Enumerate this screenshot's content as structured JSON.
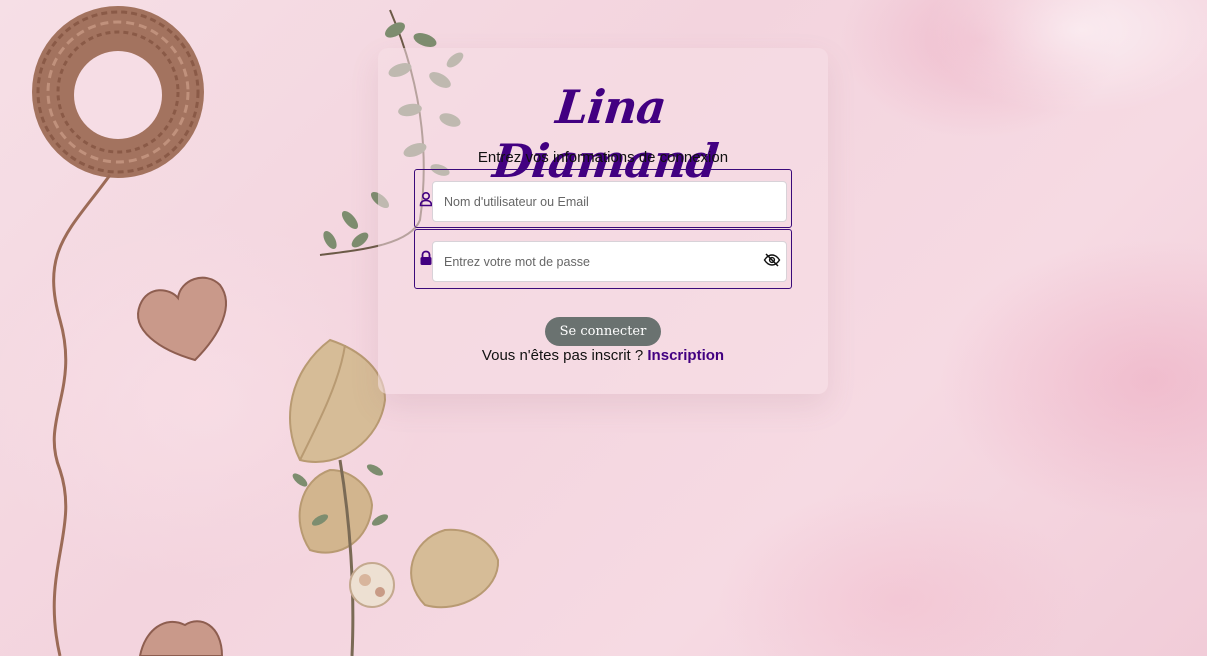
{
  "brand": {
    "title": "Lina Diamand"
  },
  "login": {
    "subtitle": "Entrez vos informations de connexion",
    "username": {
      "value": "",
      "placeholder": "Nom d'utilisateur ou Email",
      "icon": "user-icon"
    },
    "password": {
      "value": "",
      "placeholder": "Entrez votre mot de passe",
      "icon": "lock-icon",
      "toggle_icon": "eye-slash-icon"
    },
    "submit_label": "Se connecter",
    "signup_prompt": "Vous n'êtes pas inscrit ?",
    "signup_link": "Inscription"
  },
  "colors": {
    "accent": "#420081",
    "button": "#6a7270",
    "background": "#f4d8e1"
  }
}
